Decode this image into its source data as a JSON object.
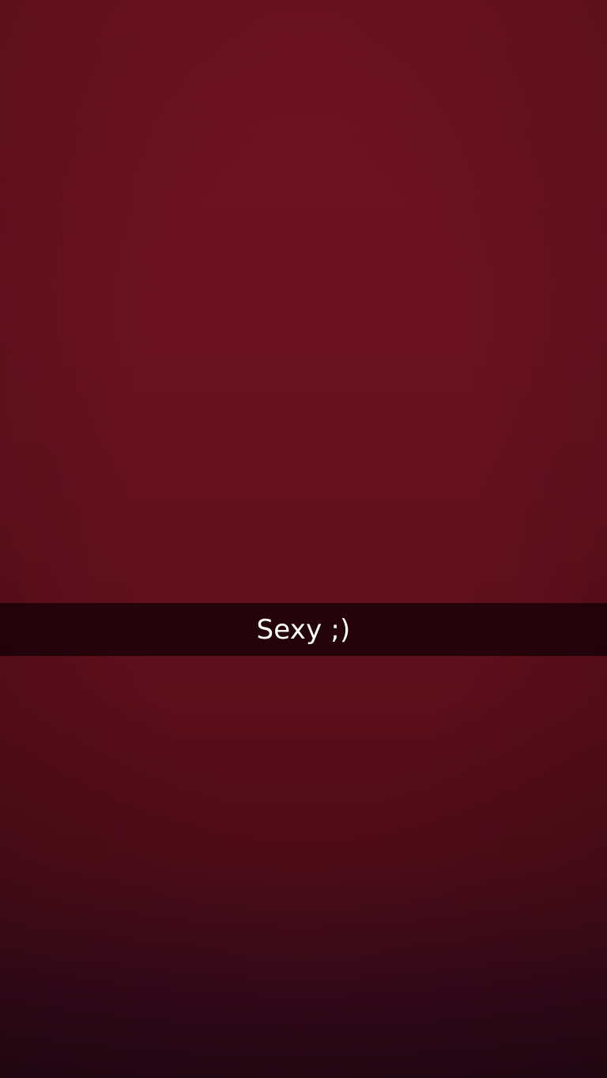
{
  "snap": {
    "background_color_top": "#6e1220",
    "background_color_bottom": "#260814",
    "caption": {
      "text": "Sexy ;)",
      "bar_color": "#140006",
      "text_color": "#ffffff"
    }
  }
}
